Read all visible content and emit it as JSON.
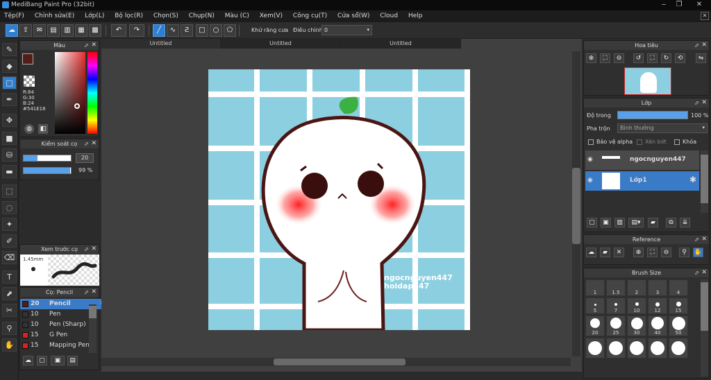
{
  "app": {
    "title": "MediBang Paint Pro (32bit)"
  },
  "window_buttons": [
    "‒",
    "❐",
    "✕",
    "✕"
  ],
  "menu": [
    "Tệp(F)",
    "Chỉnh sửa(E)",
    "Lớp(L)",
    "Bộ lọc(R)",
    "Chọn(S)",
    "Chụp(N)",
    "Màu (C)",
    "Xem(V)",
    "Công cụ(T)",
    "Cửa sổ(W)",
    "Cloud",
    "Help"
  ],
  "toolbar": {
    "antialias_label": "Khử răng cưa",
    "adjust_label": "Điều chỉnh",
    "adjust_value": "0"
  },
  "tabs": [
    "Untitled",
    "Untitled",
    "Untitled"
  ],
  "color_panel": {
    "title": "Màu",
    "r": "R:84",
    "g": "G:30",
    "b": "B:24",
    "hex": "#541E18",
    "accent": "#541E18"
  },
  "brush_control": {
    "title": "Kiểm soát cọ",
    "size_value": "20",
    "opacity_value": "99 %",
    "size_fraction": 0.3,
    "opacity_fraction": 0.99
  },
  "brush_preview": {
    "title": "Xem trước cọ",
    "size_label": "1.45mm"
  },
  "brush_list": {
    "title": "Cọ: Pencil",
    "items": [
      {
        "size": "20",
        "name": "Pencil",
        "color": "#541E18"
      },
      {
        "size": "10",
        "name": "Pen",
        "color": "#333333"
      },
      {
        "size": "10",
        "name": "Pen (Sharp)",
        "color": "#333333"
      },
      {
        "size": "15",
        "name": "G Pen",
        "color": "#e02020"
      },
      {
        "size": "15",
        "name": "Mapping Pen",
        "color": "#e02020"
      }
    ]
  },
  "navigator": {
    "title": "Hoa tiêu"
  },
  "layer_panel": {
    "title": "Lớp",
    "opacity_label": "Độ trong",
    "opacity_value": "100 %",
    "opacity_fraction": 1.0,
    "blend_label": "Pha trộn",
    "blend_value": "Bình thường",
    "protect_alpha": "Bảo vệ alpha",
    "clip": "Xén bớt",
    "lock": "Khóa",
    "layers": [
      {
        "name": "ngocnguyen447"
      },
      {
        "name": "Lớp1"
      }
    ]
  },
  "reference_panel": {
    "title": "Reference"
  },
  "brush_size_panel": {
    "title": "Brush Size",
    "row1": [
      "1",
      "1.5",
      "2",
      "3",
      "4"
    ],
    "row2": [
      "5",
      "7",
      "10",
      "12",
      "15"
    ],
    "row3": [
      "20",
      "25",
      "30",
      "40",
      "50"
    ]
  },
  "artwork": {
    "watermark_line1": "ngocnguyen447",
    "watermark_line2": "hoidap247"
  }
}
